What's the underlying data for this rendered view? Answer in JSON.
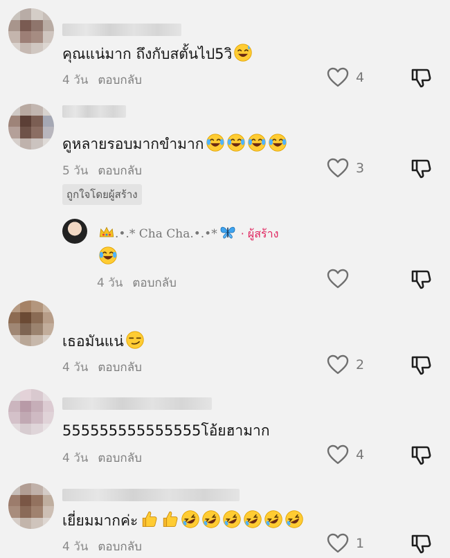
{
  "comments": [
    {
      "text": "คุณแน่มาก ถึงกับสตั้นไป5วิ",
      "emojis": [
        "sweat-smile"
      ],
      "time": "4 วัน",
      "reply": "ตอบกลับ",
      "likes": "4"
    },
    {
      "text": "ดูหลายรอบมากขำมาก",
      "emojis": [
        "joy",
        "joy",
        "joy",
        "joy"
      ],
      "time": "5 วัน",
      "reply": "ตอบกลับ",
      "likes": "3",
      "badge": "ถูกใจโดยผู้สร้าง",
      "creator_reply": {
        "name": ".•.* Cha Cha.•.•*",
        "creator_label": "· ผู้สร้าง",
        "emojis": [
          "crown",
          "butterfly"
        ],
        "body_emojis": [
          "joy"
        ],
        "time": "4 วัน",
        "reply": "ตอบกลับ"
      }
    },
    {
      "text": "เธอมันแน่",
      "emojis": [
        "smirk"
      ],
      "time": "4 วัน",
      "reply": "ตอบกลับ",
      "likes": "2"
    },
    {
      "text": "555555555555555โอ้ยฮามาก",
      "emojis": [],
      "time": "4 วัน",
      "reply": "ตอบกลับ",
      "likes": "4"
    },
    {
      "text": "เยี่ยมมากค่ะ",
      "emojis": [
        "thumbs-up",
        "thumbs-up",
        "rofl",
        "rofl",
        "rofl",
        "rofl",
        "rofl",
        "rofl"
      ],
      "time": "4 วัน",
      "reply": "ตอบกลับ",
      "likes": "1"
    }
  ],
  "colors": {
    "background": "#f2f2f2",
    "creator_accent": "#e0245e",
    "meta_text": "#8a8a8a"
  }
}
